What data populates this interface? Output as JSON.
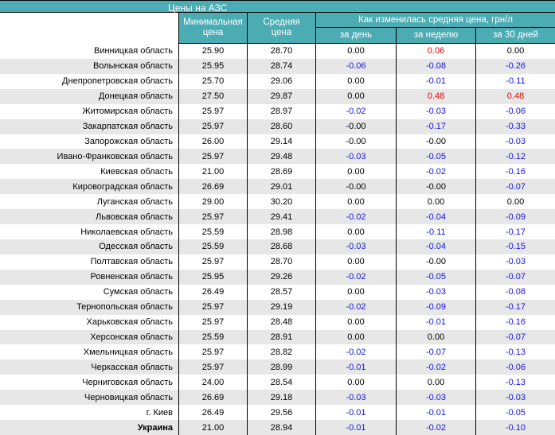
{
  "title": "Цены на АЗС",
  "colors": {
    "accent": "#4BACB4",
    "stripe": "#E7E7E7",
    "decrease": "#1414E6",
    "increase": "#EE0000",
    "neutral": "#000000",
    "header_text": "#FFFFFF"
  },
  "header": {
    "min_price": "Минимальная\nцена",
    "avg_price": "Средняя\nцена",
    "change_group": "Как изменилась средняя цена, грн/л",
    "sub_day": "за день",
    "sub_week": "за неделю",
    "sub_month": "за 30 дней"
  },
  "rows": [
    {
      "region": "Винницкая область",
      "min": "25.90",
      "avg": "28.70",
      "day": "0.00",
      "week": "0.06",
      "month": "0.00"
    },
    {
      "region": "Волынская область",
      "min": "25.95",
      "avg": "28.74",
      "day": "-0.06",
      "week": "-0.08",
      "month": "-0.26"
    },
    {
      "region": "Днепропетровская область",
      "min": "25.70",
      "avg": "29.06",
      "day": "0.00",
      "week": "-0.01",
      "month": "-0.11"
    },
    {
      "region": "Донецкая область",
      "min": "27.50",
      "avg": "29.87",
      "day": "0.00",
      "week": "0.48",
      "month": "0.48"
    },
    {
      "region": "Житомирская область",
      "min": "25.97",
      "avg": "28.97",
      "day": "-0.02",
      "week": "-0.03",
      "month": "-0.06"
    },
    {
      "region": "Закарпатская область",
      "min": "25.97",
      "avg": "28.60",
      "day": "-0.00",
      "week": "-0.17",
      "month": "-0.33"
    },
    {
      "region": "Запорожская область",
      "min": "26.00",
      "avg": "29.14",
      "day": "-0.00",
      "week": "-0.00",
      "month": "-0.03"
    },
    {
      "region": "Ивано-Франковская область",
      "min": "25.97",
      "avg": "29.48",
      "day": "-0.03",
      "week": "-0.05",
      "month": "-0.12"
    },
    {
      "region": "Киевская область",
      "min": "21.00",
      "avg": "28.69",
      "day": "0.00",
      "week": "-0.02",
      "month": "-0.16"
    },
    {
      "region": "Кировоградская область",
      "min": "26.69",
      "avg": "29.01",
      "day": "-0.00",
      "week": "-0.00",
      "month": "-0.07"
    },
    {
      "region": "Луганская область",
      "min": "29.00",
      "avg": "30.20",
      "day": "0.00",
      "week": "0.00",
      "month": "0.00"
    },
    {
      "region": "Львовская область",
      "min": "25.97",
      "avg": "29.41",
      "day": "-0.02",
      "week": "-0.04",
      "month": "-0.09"
    },
    {
      "region": "Николаевская область",
      "min": "25.59",
      "avg": "28.98",
      "day": "0.00",
      "week": "-0.11",
      "month": "-0.17"
    },
    {
      "region": "Одесская область",
      "min": "25.59",
      "avg": "28.68",
      "day": "-0.03",
      "week": "-0.04",
      "month": "-0.15"
    },
    {
      "region": "Полтавская область",
      "min": "25.97",
      "avg": "28.70",
      "day": "0.00",
      "week": "-0.00",
      "month": "-0.03"
    },
    {
      "region": "Ровненская область",
      "min": "25.95",
      "avg": "29.26",
      "day": "-0.02",
      "week": "-0.05",
      "month": "-0.07"
    },
    {
      "region": "Сумская область",
      "min": "26.49",
      "avg": "28.57",
      "day": "0.00",
      "week": "-0.03",
      "month": "-0.08"
    },
    {
      "region": "Тернопольская область",
      "min": "25.97",
      "avg": "29.19",
      "day": "-0.02",
      "week": "-0.09",
      "month": "-0.17"
    },
    {
      "region": "Харьковская область",
      "min": "25.97",
      "avg": "28.48",
      "day": "0.00",
      "week": "-0.01",
      "month": "-0.16"
    },
    {
      "region": "Херсонская область",
      "min": "25.59",
      "avg": "28.91",
      "day": "0.00",
      "week": "0.00",
      "month": "-0.07"
    },
    {
      "region": "Хмельницкая область",
      "min": "25.97",
      "avg": "28.82",
      "day": "-0.02",
      "week": "-0.07",
      "month": "-0.13"
    },
    {
      "region": "Черкасская область",
      "min": "25.97",
      "avg": "28.99",
      "day": "-0.01",
      "week": "-0.02",
      "month": "-0.06"
    },
    {
      "region": "Черниговская область",
      "min": "24.00",
      "avg": "28.54",
      "day": "0.00",
      "week": "0.00",
      "month": "-0.13"
    },
    {
      "region": "Черновицкая область",
      "min": "26.69",
      "avg": "29.18",
      "day": "-0.03",
      "week": "-0.03",
      "month": "-0.03"
    },
    {
      "region": "г. Киев",
      "min": "26.49",
      "avg": "29.56",
      "day": "-0.01",
      "week": "-0.01",
      "month": "-0.05"
    },
    {
      "region": "Украина",
      "min": "21.00",
      "avg": "28.94",
      "day": "-0.01",
      "week": "-0.02",
      "month": "-0.10",
      "bold": true
    }
  ]
}
